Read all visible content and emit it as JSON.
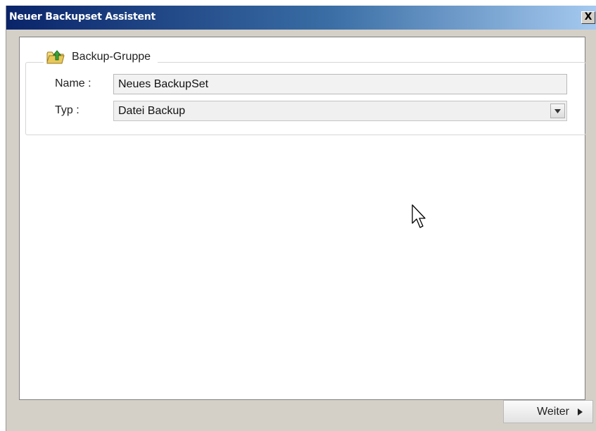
{
  "window": {
    "title": "Neuer Backupset Assistent",
    "close_label": "X"
  },
  "group": {
    "title": "Backup-Gruppe",
    "icon": "folder-upload-icon"
  },
  "form": {
    "name_label": "Name :",
    "name_value": "Neues BackupSet",
    "type_label": "Typ :",
    "type_value": "Datei Backup"
  },
  "footer": {
    "next_label": "Weiter"
  },
  "colors": {
    "titlebar_start": "#0a246a",
    "titlebar_end": "#a6caf0",
    "window_bg": "#d4d0c8",
    "content_bg": "#ffffff"
  }
}
